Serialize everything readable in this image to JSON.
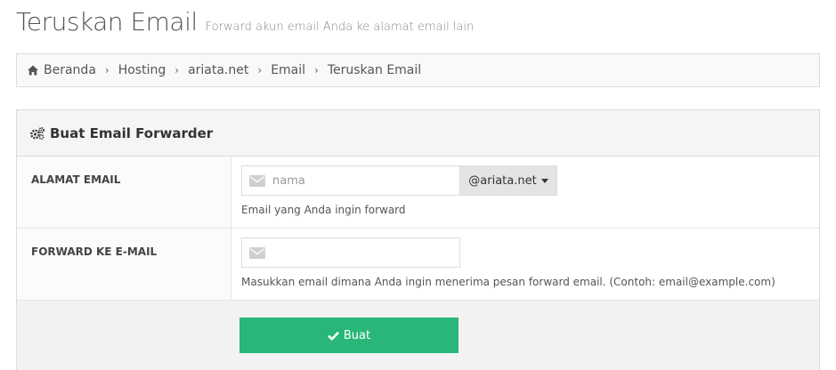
{
  "header": {
    "title": "Teruskan Email",
    "subtitle": "Forward akun email Anda ke alamat email lain"
  },
  "breadcrumb": {
    "items": [
      "Beranda",
      "Hosting",
      "ariata.net",
      "Email",
      "Teruskan Email"
    ],
    "separator": "›"
  },
  "panel": {
    "title": "Buat Email Forwarder",
    "fields": [
      {
        "label": "ALAMAT EMAIL",
        "value": "",
        "placeholder": "nama",
        "domain": "@ariata.net",
        "help": "Email yang Anda ingin forward"
      },
      {
        "label": "FORWARD KE E-MAIL",
        "value": "",
        "placeholder": "",
        "help": "Masukkan email dimana Anda ingin menerima pesan forward email. (Contoh: email@example.com)"
      }
    ],
    "submit_label": "Buat"
  },
  "colors": {
    "accent_green": "#28b779",
    "border": "#dddddd",
    "panel_heading_bg": "#f5f5f5"
  },
  "icons": {
    "breadcrumb_home": "home-icon",
    "panel_heading": "cogs-icon",
    "email_input": "envelope-icon",
    "submit": "check-icon"
  }
}
